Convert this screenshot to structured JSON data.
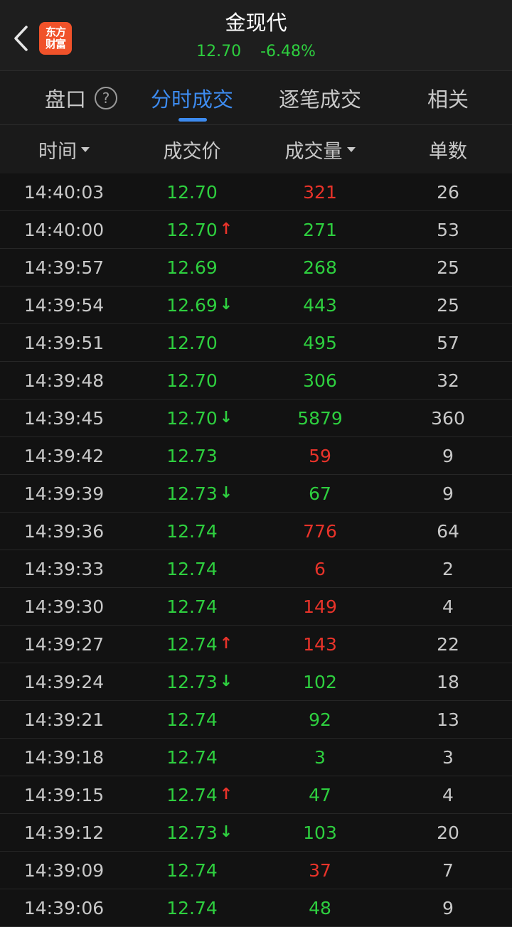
{
  "header": {
    "title": "金现代",
    "price": "12.70",
    "change_pct": "-6.48%",
    "logo_line1": "东方",
    "logo_line2": "财富",
    "back_icon": "chevron-left-icon"
  },
  "tabs": [
    {
      "label": "盘口",
      "active": false
    },
    {
      "label": "分时成交",
      "active": true
    },
    {
      "label": "逐笔成交",
      "active": false
    },
    {
      "label": "相关",
      "active": false
    }
  ],
  "help_glyph": "?",
  "columns": [
    "时间",
    "成交价",
    "成交量",
    "单数"
  ],
  "colors": {
    "up": "#e8332a",
    "down": "#2ecf3f",
    "accent": "#3d8bef"
  },
  "trades": [
    {
      "time": "14:40:03",
      "price": "12.70",
      "arrow": "",
      "volume": "321",
      "vol_color": "red",
      "count": "26"
    },
    {
      "time": "14:40:00",
      "price": "12.70",
      "arrow": "up",
      "volume": "271",
      "vol_color": "green",
      "count": "53"
    },
    {
      "time": "14:39:57",
      "price": "12.69",
      "arrow": "",
      "volume": "268",
      "vol_color": "green",
      "count": "25"
    },
    {
      "time": "14:39:54",
      "price": "12.69",
      "arrow": "down",
      "volume": "443",
      "vol_color": "green",
      "count": "25"
    },
    {
      "time": "14:39:51",
      "price": "12.70",
      "arrow": "",
      "volume": "495",
      "vol_color": "green",
      "count": "57"
    },
    {
      "time": "14:39:48",
      "price": "12.70",
      "arrow": "",
      "volume": "306",
      "vol_color": "green",
      "count": "32"
    },
    {
      "time": "14:39:45",
      "price": "12.70",
      "arrow": "down",
      "volume": "5879",
      "vol_color": "green",
      "count": "360"
    },
    {
      "time": "14:39:42",
      "price": "12.73",
      "arrow": "",
      "volume": "59",
      "vol_color": "red",
      "count": "9"
    },
    {
      "time": "14:39:39",
      "price": "12.73",
      "arrow": "down",
      "volume": "67",
      "vol_color": "green",
      "count": "9"
    },
    {
      "time": "14:39:36",
      "price": "12.74",
      "arrow": "",
      "volume": "776",
      "vol_color": "red",
      "count": "64"
    },
    {
      "time": "14:39:33",
      "price": "12.74",
      "arrow": "",
      "volume": "6",
      "vol_color": "red",
      "count": "2"
    },
    {
      "time": "14:39:30",
      "price": "12.74",
      "arrow": "",
      "volume": "149",
      "vol_color": "red",
      "count": "4"
    },
    {
      "time": "14:39:27",
      "price": "12.74",
      "arrow": "up",
      "volume": "143",
      "vol_color": "red",
      "count": "22"
    },
    {
      "time": "14:39:24",
      "price": "12.73",
      "arrow": "down",
      "volume": "102",
      "vol_color": "green",
      "count": "18"
    },
    {
      "time": "14:39:21",
      "price": "12.74",
      "arrow": "",
      "volume": "92",
      "vol_color": "green",
      "count": "13"
    },
    {
      "time": "14:39:18",
      "price": "12.74",
      "arrow": "",
      "volume": "3",
      "vol_color": "green",
      "count": "3"
    },
    {
      "time": "14:39:15",
      "price": "12.74",
      "arrow": "up",
      "volume": "47",
      "vol_color": "green",
      "count": "4"
    },
    {
      "time": "14:39:12",
      "price": "12.73",
      "arrow": "down",
      "volume": "103",
      "vol_color": "green",
      "count": "20"
    },
    {
      "time": "14:39:09",
      "price": "12.74",
      "arrow": "",
      "volume": "37",
      "vol_color": "red",
      "count": "7"
    },
    {
      "time": "14:39:06",
      "price": "12.74",
      "arrow": "",
      "volume": "48",
      "vol_color": "green",
      "count": "9"
    }
  ]
}
